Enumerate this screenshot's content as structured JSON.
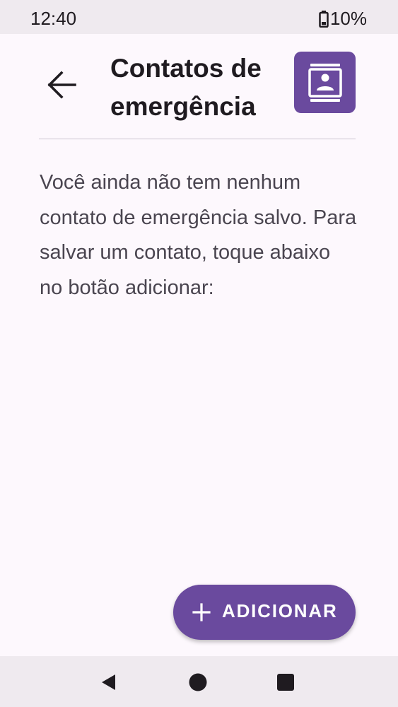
{
  "status_bar": {
    "time": "12:40",
    "battery": "10%",
    "battery_icon": "battery-low-icon"
  },
  "header": {
    "title": "Contatos de emergência",
    "back_icon": "arrow-back-icon",
    "badge_icon": "contact-card-icon"
  },
  "main": {
    "message": "Você ainda não tem nenhum contato de emergência salvo. Para salvar um contato, toque abaixo no botão adicionar:"
  },
  "fab": {
    "label": "ADICIONAR",
    "icon": "plus-icon"
  },
  "nav_bar": {
    "back_icon": "triangle-back-icon",
    "home_icon": "circle-home-icon",
    "recents_icon": "square-recents-icon"
  },
  "colors": {
    "accent": "#6a4a9e",
    "background": "#fdf8fd",
    "system_bar": "#efeaef",
    "text_primary": "#1f1b20",
    "text_secondary": "#4a4550"
  }
}
